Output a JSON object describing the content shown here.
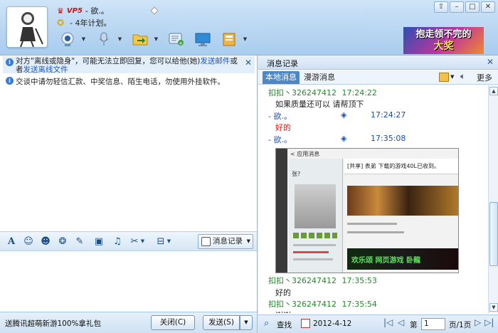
{
  "header": {
    "vip_label": "VP5",
    "nickname": "- 欲.。",
    "signature": "- 4年计划。",
    "window_buttons": [
      "⇧",
      "–",
      "□",
      "✕"
    ],
    "banner_line1": "抱走领不完的",
    "banner_line2": "大奖"
  },
  "left": {
    "notice_offline_a": "对方\"离线或隐身\"，可能无法立即回复，您可以给他(她)",
    "notice_offline_link1": "发送邮件",
    "notice_offline_b": "或者",
    "notice_offline_link2": "发送离线文件",
    "notice_security": "交谈中请勿轻信汇款、中奖信息、陌生电话，勿使用外挂软件。",
    "msg_record_label": "消息记录",
    "ad_text": "送腾讯超萌新游100%拿礼包",
    "close_label": "关闭(C)",
    "send_label": "发送(S)"
  },
  "right": {
    "title": "消息记录",
    "tab_local": "本地消息",
    "tab_roam": "漫游消息",
    "more_label": "更多",
    "messages": [
      {
        "sender": "扣扣丶326247412",
        "time": "17:24:22",
        "text": "如果质量还可以   请帮顶下"
      },
      {
        "sender": "- 欲.。",
        "time": "17:24:27",
        "text": "好的"
      },
      {
        "sender": "- 欲.。",
        "time": "17:35:08",
        "text": ""
      },
      {
        "sender": "扣扣丶326247412",
        "time": "17:35:53",
        "text": "好的"
      },
      {
        "sender": "扣扣丶326247412",
        "time": "17:35:54",
        "text": "谢谢"
      }
    ],
    "embedded": {
      "tab": "< 应用消息",
      "heading": "[共享] 表弟 下载的游戏40L已收到。",
      "game_text": "欢乐颂 网页游戏 卧龍",
      "side_name": "张?"
    },
    "search_label": "查找",
    "date": "2012-4-12",
    "page_prefix": "第",
    "page_value": "1",
    "page_suffix": "页/1页"
  },
  "colors": {
    "accent": "#4f86c6",
    "link": "#1a58c7",
    "sender_green": "#238a2b",
    "sender_blue": "#1b4ea8",
    "reply_red": "#e01010"
  }
}
